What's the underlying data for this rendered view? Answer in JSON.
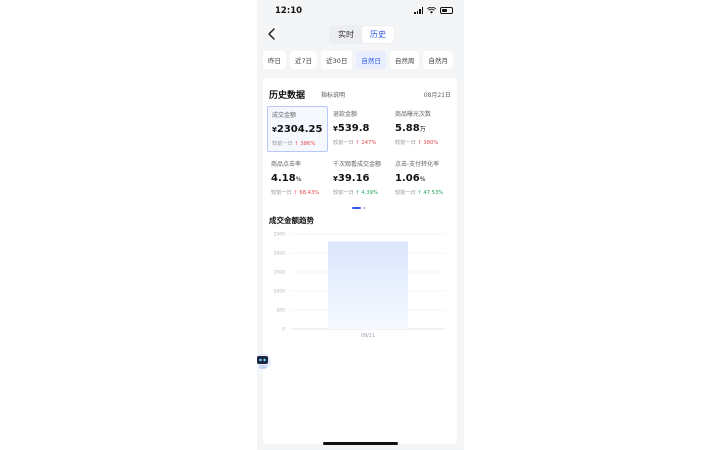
{
  "status_bar": {
    "time": "12:10"
  },
  "nav": {
    "tabs": [
      {
        "label": "实时",
        "active": false
      },
      {
        "label": "历史",
        "active": true
      }
    ]
  },
  "date_tabs": [
    {
      "label": "昨日",
      "selected": false
    },
    {
      "label": "近7日",
      "selected": false
    },
    {
      "label": "近30日",
      "selected": false
    },
    {
      "label": "自然日",
      "selected": true
    },
    {
      "label": "自然周",
      "selected": false
    },
    {
      "label": "自然月",
      "selected": false
    }
  ],
  "card": {
    "title": "历史数据",
    "subtitle": "指标说明",
    "date": "08月21日"
  },
  "metrics": [
    {
      "label": "成交金额",
      "currency": "¥",
      "value": "2304.25",
      "unit": "",
      "compare_label": "较前一日",
      "compare_value": "↑ 386%",
      "trend_color": "#e5484d",
      "selected": true
    },
    {
      "label": "退款金额",
      "currency": "¥",
      "value": "539.8",
      "unit": "",
      "compare_label": "较前一日",
      "compare_value": "↑ 247%",
      "trend_color": "#e5484d",
      "selected": false
    },
    {
      "label": "商品曝光次数",
      "currency": "",
      "value": "5.88",
      "unit": "万",
      "compare_label": "较前一日",
      "compare_value": "↑ 380%",
      "trend_color": "#e5484d",
      "selected": false
    },
    {
      "label": "商品点击率",
      "currency": "",
      "value": "4.18",
      "unit": "%",
      "compare_label": "较前一日",
      "compare_value": "↑ 68.43%",
      "trend_color": "#e5484d",
      "selected": false
    },
    {
      "label": "千次观看成交金额",
      "currency": "¥",
      "value": "39.16",
      "unit": "",
      "compare_label": "较前一日",
      "compare_value": "↑ 4.39%",
      "trend_color": "#22a35a",
      "selected": false
    },
    {
      "label": "点击-支付转化率",
      "currency": "",
      "value": "1.06",
      "unit": "%",
      "compare_label": "较前一日",
      "compare_value": "↑ 47.53%",
      "trend_color": "#22a35a",
      "selected": false
    }
  ],
  "pager": {
    "pages": 2,
    "current": 1
  },
  "chart_title": "成交金额趋势",
  "chart_data": {
    "type": "bar",
    "categories": [
      "08/21"
    ],
    "values": [
      2304.25
    ],
    "ylim": [
      0,
      2500
    ],
    "yticks": [
      "0",
      "500",
      "1000",
      "1500",
      "2000",
      "2500"
    ],
    "title": "成交金额趋势",
    "xlabel": "",
    "ylabel": "",
    "grid": true,
    "bar_color": "#dde7fd"
  },
  "colors": {
    "accent": "#2f56e8"
  }
}
